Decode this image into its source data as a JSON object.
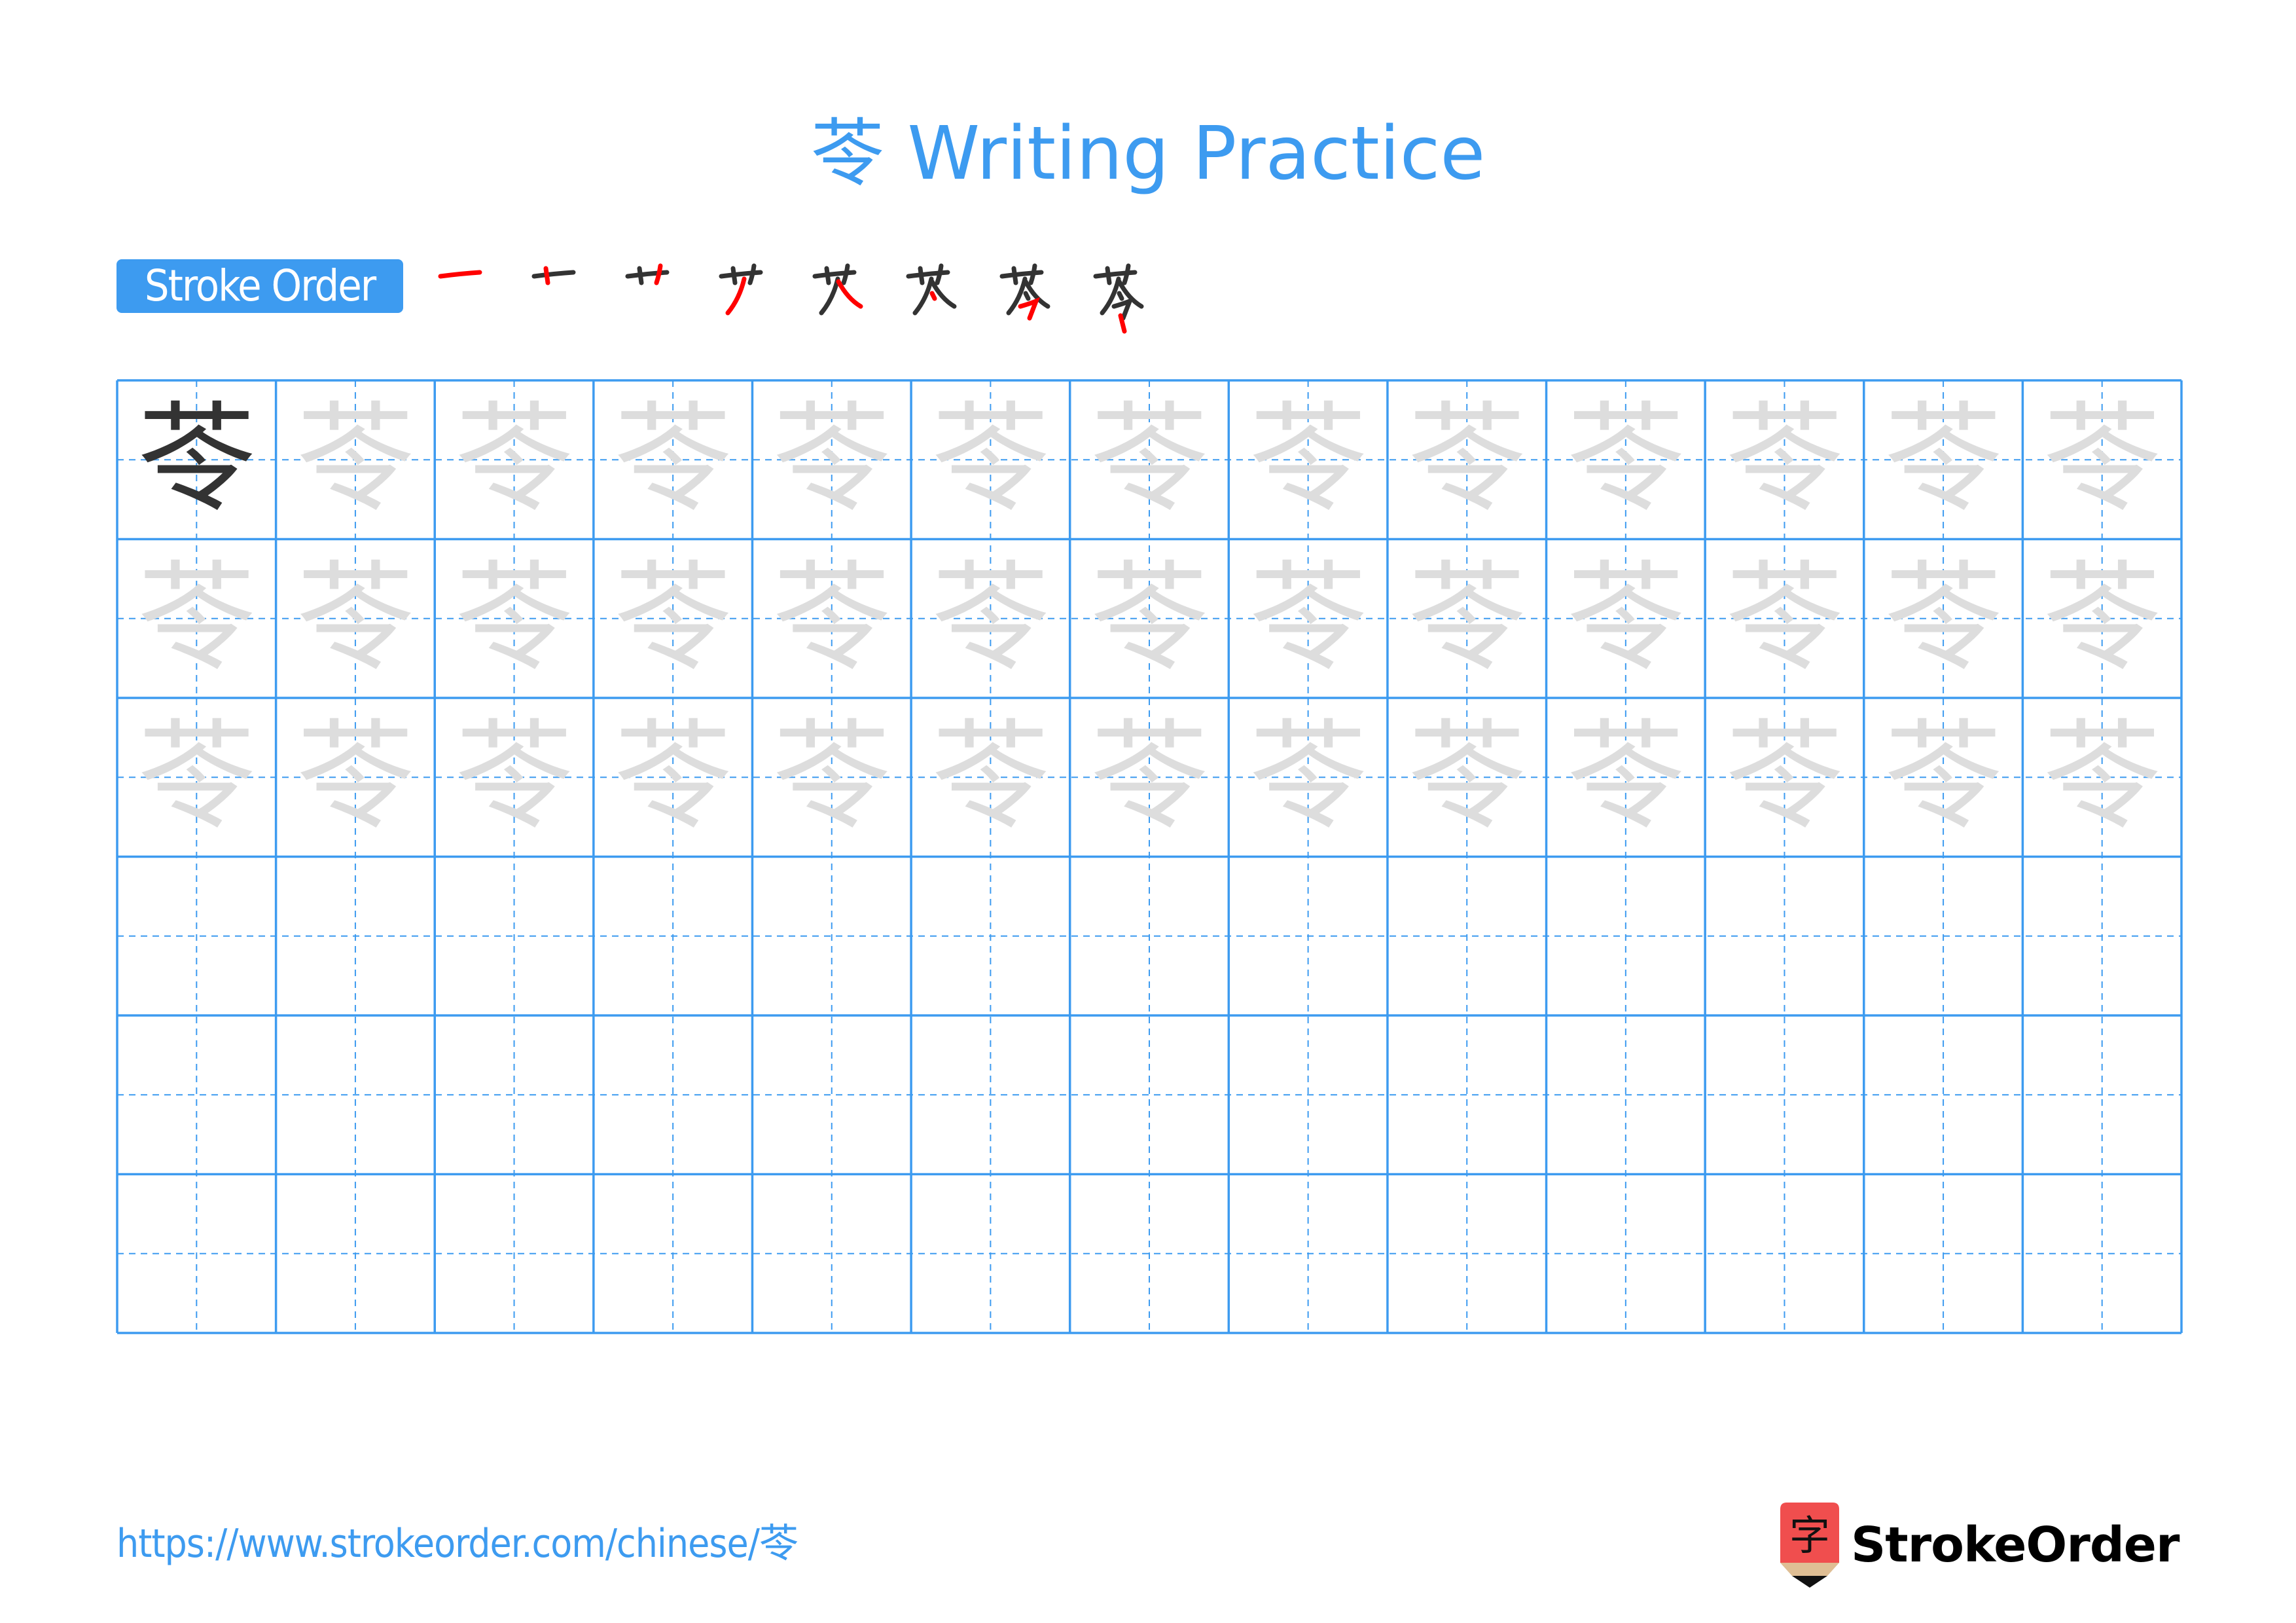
{
  "page": {
    "title_char": "苓",
    "title_text": "Writing Practice",
    "accent_color": "#3d9bf0",
    "model_color": "#333333",
    "trace_color": "#dddddd",
    "highlight_color": "#ff0000"
  },
  "stroke_order": {
    "label": "Stroke Order",
    "step_count": 8,
    "character": "苓"
  },
  "practice_grid": {
    "character": "苓",
    "columns": 13,
    "rows": 6,
    "model_cells": 1,
    "trace_rows": 3,
    "empty_rows": 3
  },
  "footer": {
    "url": "https://www.strokeorder.com/chinese/苓",
    "brand_name": "StrokeOrder",
    "brand_logo_char": "字"
  }
}
